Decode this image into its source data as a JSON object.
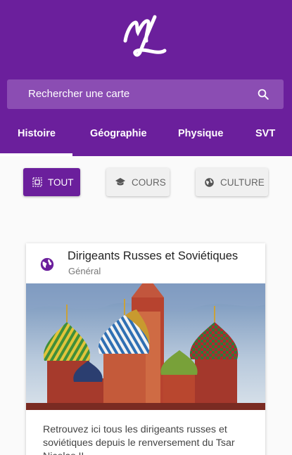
{
  "header": {
    "logo_text": "ML",
    "search": {
      "placeholder": "Rechercher une carte",
      "icon": "search-icon"
    },
    "tabs": [
      {
        "label": "Histoire",
        "active": true
      },
      {
        "label": "Géographie",
        "active": false
      },
      {
        "label": "Physique",
        "active": false
      },
      {
        "label": "SVT",
        "active": false
      }
    ]
  },
  "filters": [
    {
      "label": "TOUT",
      "icon": "all-select-icon",
      "active": true
    },
    {
      "label": "COURS",
      "icon": "school-icon",
      "active": false
    },
    {
      "label": "CULTURE",
      "icon": "globe-icon",
      "active": false
    }
  ],
  "card": {
    "icon": "globe-icon",
    "title": "Dirigeants Russes et Soviétiques",
    "subtitle": "Général",
    "description": "Retrouvez ici tous les dirigeants russes et soviétiques depuis le renversement du Tsar Nicolas II",
    "image": "saint-basil-cathedral-image"
  },
  "colors": {
    "primary": "#6b1f9c",
    "search_bg": "#8b4db3"
  }
}
